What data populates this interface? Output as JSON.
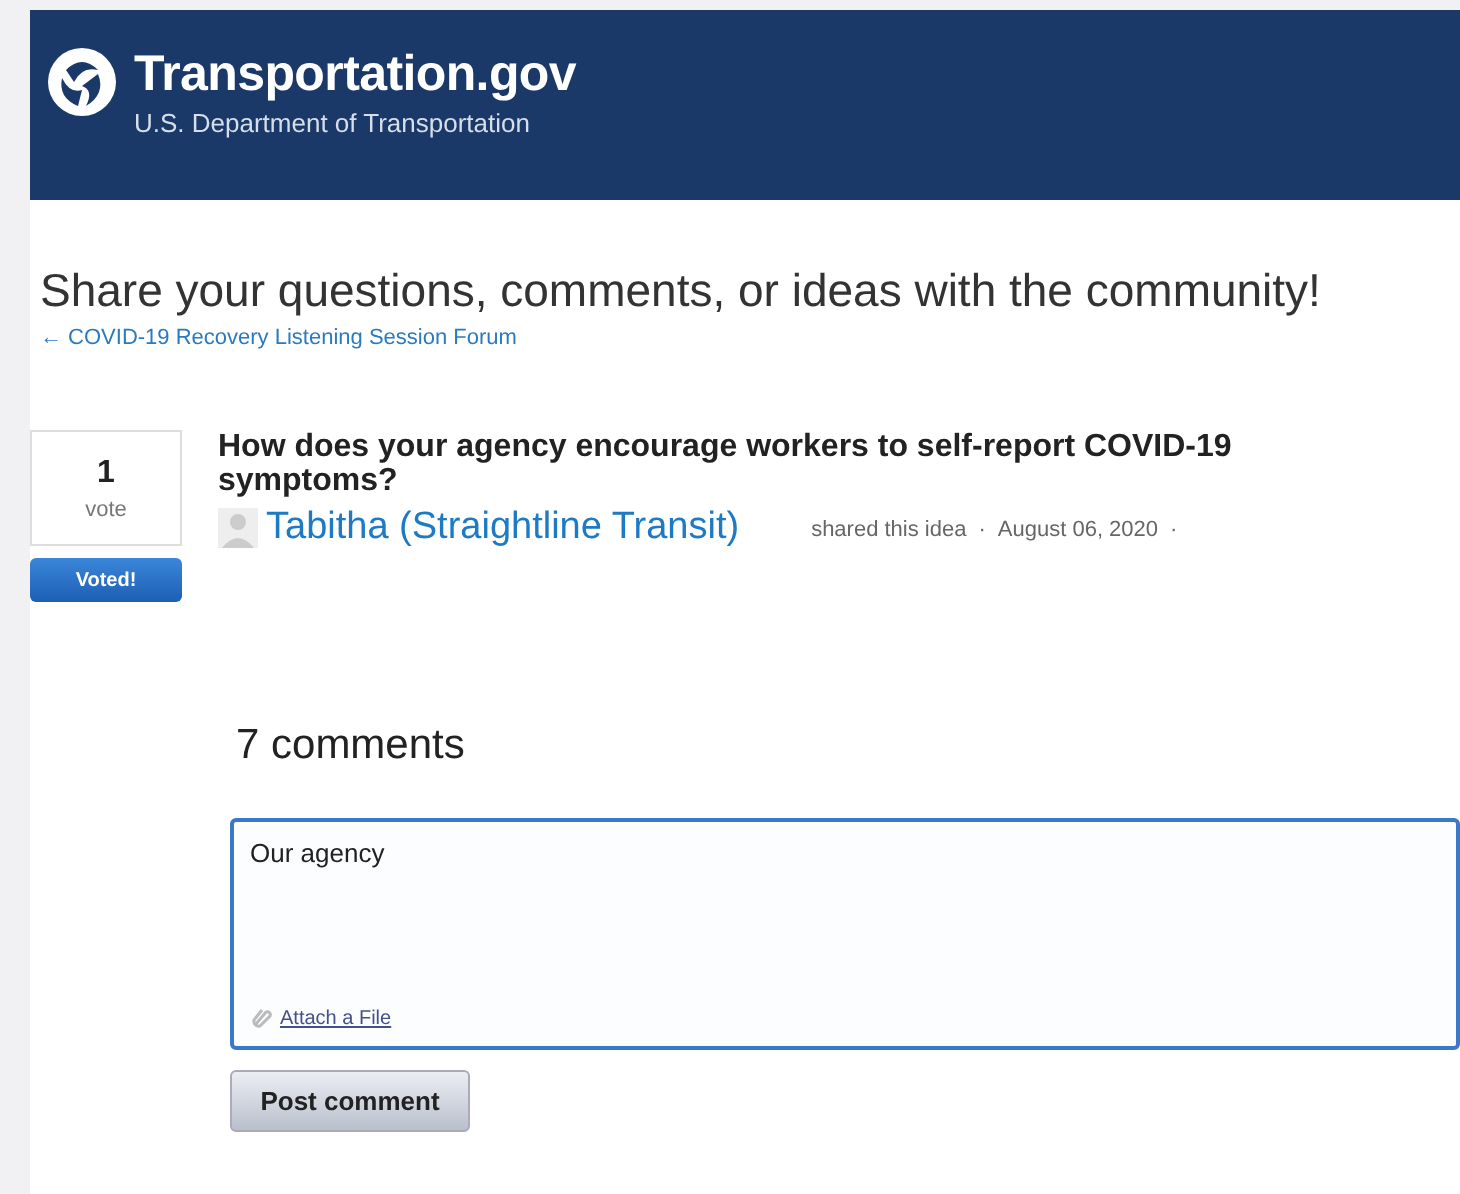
{
  "header": {
    "title": "Transportation.gov",
    "subtitle": "U.S. Department of Transportation"
  },
  "page": {
    "heading": "Share your questions, comments, or ideas with the community!",
    "back_link": "← COVID-19 Recovery Listening Session Forum"
  },
  "idea": {
    "votes": "1",
    "votes_label": "vote",
    "vote_button": "Voted!",
    "voted": true,
    "title": "How does your agency encourage workers to self-report COVID-19 symptoms?",
    "author": "Tabitha (Straightline Transit)",
    "shared": "shared this idea",
    "separator": "·",
    "date": "August 06, 2020",
    "trailing": "·"
  },
  "comments": {
    "count": "7 comments",
    "field_value": "Our agency",
    "attach": "Attach a File",
    "button": "Post comment"
  }
}
